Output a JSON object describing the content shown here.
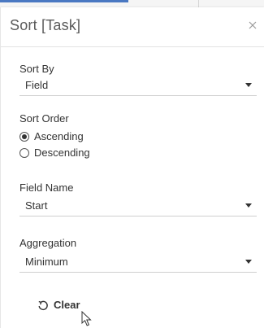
{
  "dialog": {
    "title": "Sort [Task]",
    "close_icon": "close-icon"
  },
  "sort_by": {
    "label": "Sort By",
    "value": "Field"
  },
  "sort_order": {
    "label": "Sort Order",
    "options": [
      {
        "label": "Ascending",
        "checked": true
      },
      {
        "label": "Descending",
        "checked": false
      }
    ]
  },
  "field_name": {
    "label": "Field Name",
    "value": "Start"
  },
  "aggregation": {
    "label": "Aggregation",
    "value": "Minimum"
  },
  "clear": {
    "label": "Clear",
    "icon": "undo-icon"
  },
  "colors": {
    "accent": "#4a78c2",
    "text": "#333333",
    "title": "#5a5a5a"
  }
}
